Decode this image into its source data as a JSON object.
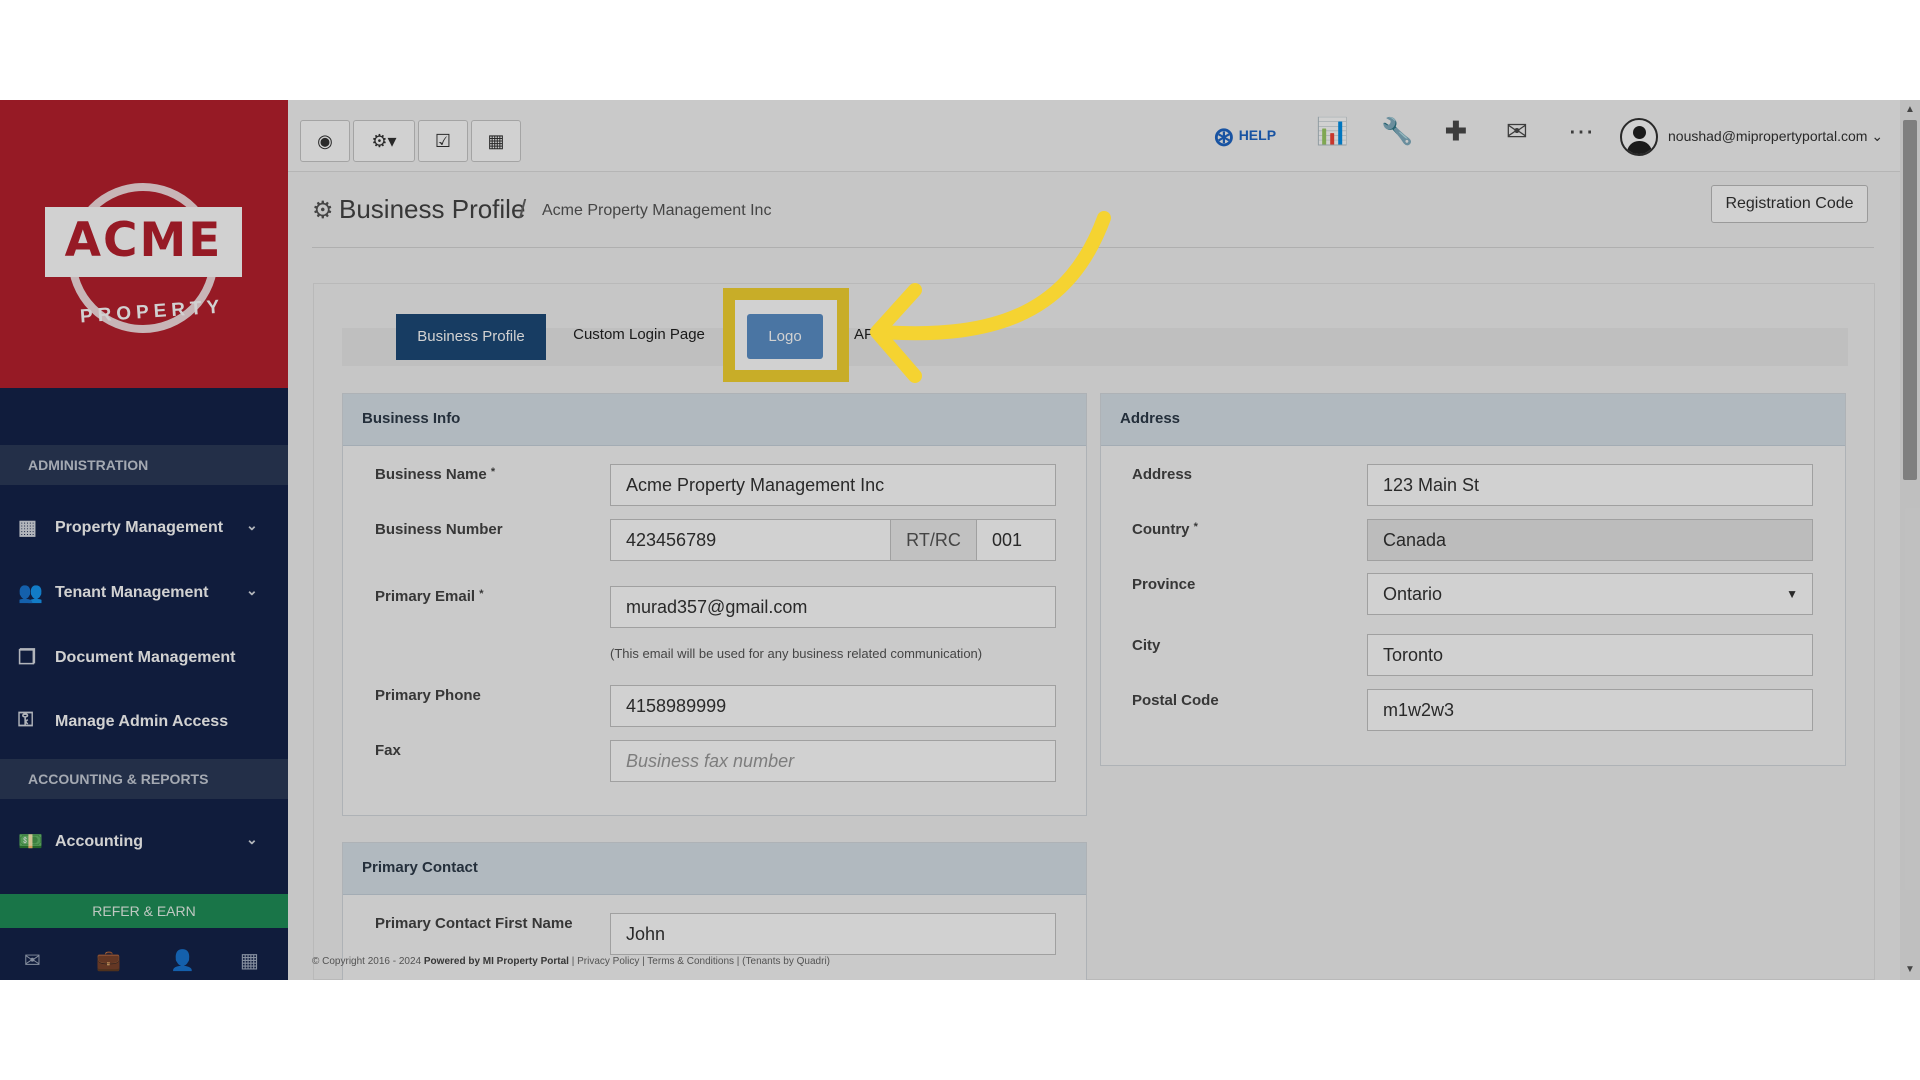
{
  "brand": {
    "logo_text": "ACME",
    "logo_sub": "PROPERTY"
  },
  "sidebar": {
    "sections": [
      "ADMINISTRATION",
      "ACCOUNTING & REPORTS"
    ],
    "items": [
      {
        "label": "Property Management",
        "icon": "building-icon"
      },
      {
        "label": "Tenant Management",
        "icon": "users-icon"
      },
      {
        "label": "Document Management",
        "icon": "documents-icon"
      },
      {
        "label": "Manage Admin Access",
        "icon": "key-icon"
      },
      {
        "label": "Accounting",
        "icon": "money-icon"
      }
    ],
    "refer_label": "REFER & EARN"
  },
  "topbar": {
    "help_label": "HELP",
    "user_email": "noushad@mipropertyportal.com"
  },
  "page": {
    "title": "Business Profile",
    "separator": "/",
    "subtitle": "Acme Property Management Inc",
    "registration_button": "Registration Code"
  },
  "tabs": [
    {
      "label": "Business Profile",
      "active": true
    },
    {
      "label": "Custom Login Page",
      "active": false
    },
    {
      "label": "Logo",
      "active": false
    },
    {
      "label": "API K",
      "active": false
    }
  ],
  "business_info": {
    "title": "Business Info",
    "business_name_label": "Business Name",
    "business_name": "Acme Property Management Inc",
    "business_number_label": "Business Number",
    "business_number": "423456789",
    "business_number_addon": "RT/RC",
    "business_number_suffix": "001",
    "primary_email_label": "Primary Email",
    "primary_email": "murad357@gmail.com",
    "email_help": "(This email will be used for any business related communication)",
    "primary_phone_label": "Primary Phone",
    "primary_phone": "4158989999",
    "fax_label": "Fax",
    "fax_placeholder": "Business fax number",
    "required_mark": "*"
  },
  "address": {
    "title": "Address",
    "address_label": "Address",
    "address": "123 Main St",
    "country_label": "Country",
    "country": "Canada",
    "province_label": "Province",
    "province": "Ontario",
    "city_label": "City",
    "city": "Toronto",
    "postal_label": "Postal Code",
    "postal": "m1w2w3"
  },
  "primary_contact": {
    "title": "Primary Contact",
    "first_name_label": "Primary Contact First Name",
    "first_name": "John"
  },
  "footer": {
    "copyright": "© Copyright 2016 - 2024",
    "powered": "Powered by MI Property Portal",
    "links": "| Privacy Policy | Terms & Conditions |",
    "tenants": "(Tenants by Quadri)"
  },
  "colors": {
    "accent": "#1d4a78",
    "brand_red": "#b7202e",
    "highlight": "#f5d331",
    "refer_green": "#1f8f58"
  }
}
